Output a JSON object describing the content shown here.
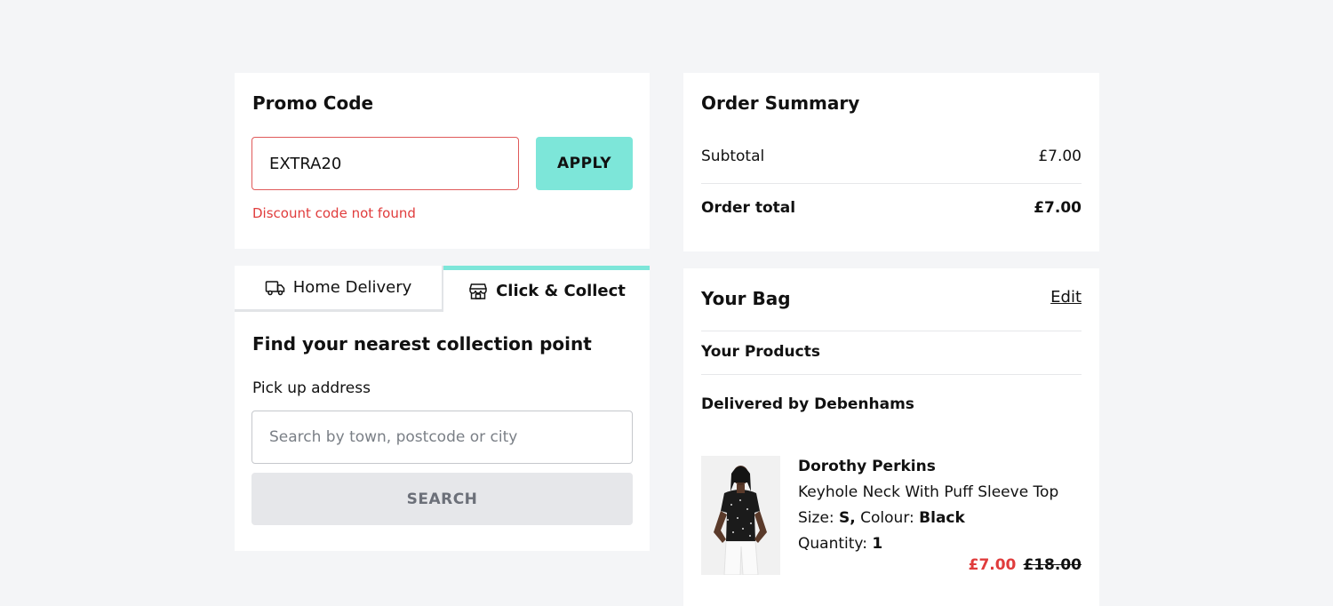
{
  "promo": {
    "title": "Promo Code",
    "input_value": "EXTRA20",
    "apply_label": "APPLY",
    "error": "Discount code not found"
  },
  "delivery": {
    "tabs": [
      {
        "label": "Home Delivery",
        "icon": "truck-icon",
        "selected": false
      },
      {
        "label": "Click & Collect",
        "icon": "store-icon",
        "selected": true
      }
    ],
    "heading": "Find your nearest collection point",
    "address_label": "Pick up address",
    "search_placeholder": "Search by town, postcode or city",
    "search_button": "SEARCH"
  },
  "summary": {
    "title": "Order Summary",
    "subtotal_label": "Subtotal",
    "subtotal_value": "£7.00",
    "total_label": "Order total",
    "total_value": "£7.00"
  },
  "bag": {
    "title": "Your Bag",
    "edit_label": "Edit",
    "products_label": "Your Products",
    "delivered_label": "Delivered by Debenhams",
    "item": {
      "brand": "Dorothy Perkins",
      "name": "Keyhole Neck With Puff Sleeve Top",
      "size_label": "Size:",
      "size": "S",
      "colour_label": "Colour:",
      "colour": "Black",
      "quantity_label": "Quantity:",
      "quantity": "1",
      "price_now": "£7.00",
      "price_was": "£18.00"
    }
  },
  "colors": {
    "accent": "#7de6d9",
    "error": "#e03c3c",
    "background": "#f4f5f7"
  }
}
